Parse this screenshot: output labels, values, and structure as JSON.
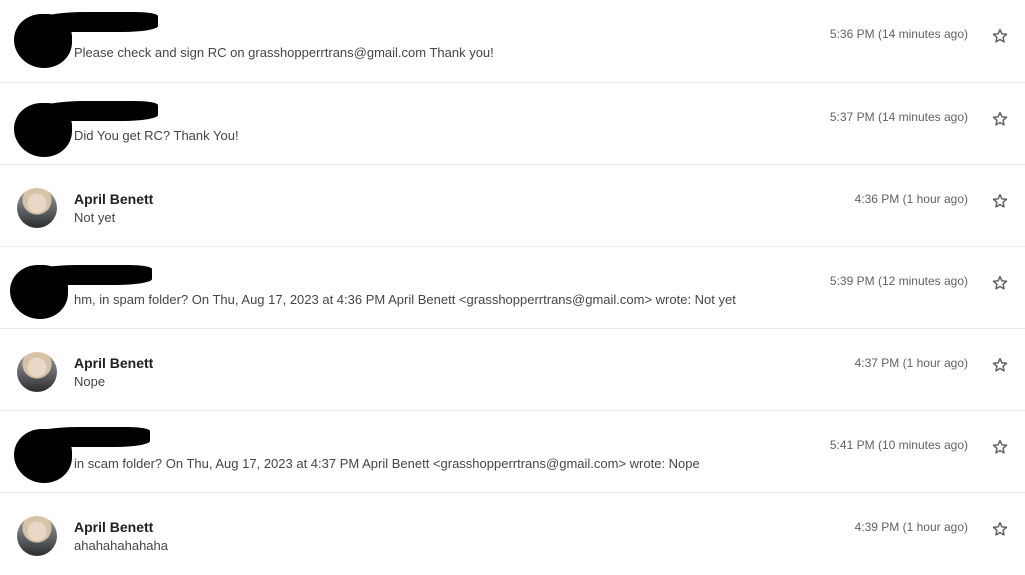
{
  "messages": [
    {
      "sender": "",
      "redacted": true,
      "snippet": "Please check and sign RC on grasshopperrtrans@gmail.com Thank you!",
      "time": "5:36 PM (14 minutes ago)",
      "star_icon": "star-outline-icon"
    },
    {
      "sender": "",
      "redacted": true,
      "snippet": "Did You get RC? Thank You!",
      "time": "5:37 PM (14 minutes ago)",
      "star_icon": "star-outline-icon"
    },
    {
      "sender": "April Benett",
      "redacted": false,
      "snippet": "Not yet",
      "time": "4:36 PM (1 hour ago)",
      "star_icon": "star-outline-icon"
    },
    {
      "sender": "",
      "redacted": true,
      "snippet": "hm, in spam folder? On Thu, Aug 17, 2023 at 4:36 PM April Benett <grasshopperrtrans@gmail.com> wrote: Not yet",
      "time": "5:39 PM (12 minutes ago)",
      "star_icon": "star-outline-icon"
    },
    {
      "sender": "April Benett",
      "redacted": false,
      "snippet": "Nope",
      "time": "4:37 PM (1 hour ago)",
      "star_icon": "star-outline-icon"
    },
    {
      "sender": "",
      "redacted": true,
      "snippet": "in scam folder? On Thu, Aug 17, 2023 at 4:37 PM April Benett <grasshopperrtrans@gmail.com> wrote: Nope",
      "time": "5:41 PM (10 minutes ago)",
      "star_icon": "star-outline-icon"
    },
    {
      "sender": "April Benett",
      "redacted": false,
      "snippet": "ahahahahahaha",
      "time": "4:39 PM (1 hour ago)",
      "star_icon": "star-outline-icon"
    }
  ]
}
